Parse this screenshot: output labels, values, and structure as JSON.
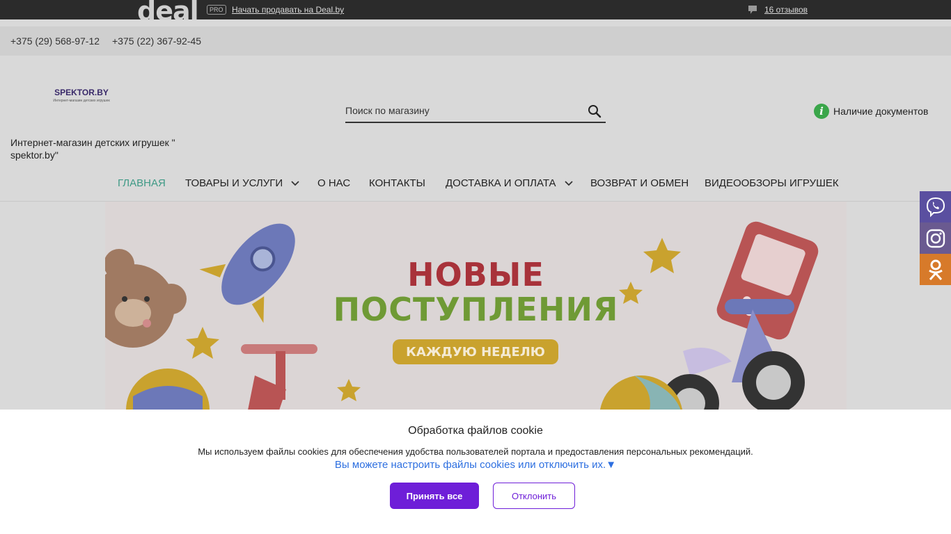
{
  "deal_bar": {
    "logo_text": "deal",
    "pro_badge": "PRO",
    "sell_link": "Начать продавать на Deal.by",
    "reviews_link": "16 отзывов"
  },
  "header": {
    "phones": [
      "+375 (29) 568-97-12",
      "+375 (22) 367-92-45"
    ],
    "logo_main": "SPEKTOR.BY",
    "logo_sub": "Интернет-магазин детских игрушек",
    "shop_title": "Интернет-магазин детских игрушек \" spektor.by\"",
    "search_placeholder": "Поиск по магазину",
    "docs_label": "Наличие документов"
  },
  "nav": {
    "items": [
      {
        "label": "Главная",
        "active": true
      },
      {
        "label": "Товары и услуги",
        "dropdown": true
      },
      {
        "label": "О нас"
      },
      {
        "label": "Контакты"
      },
      {
        "label": "Доставка и оплата",
        "dropdown": true
      },
      {
        "label": "Возврат и обмен"
      },
      {
        "label": "Видеообзоры игрушек"
      }
    ]
  },
  "banner": {
    "line1": "НОВЫЕ",
    "line2": "ПОСТУПЛЕНИЯ",
    "pill": "КАЖДУЮ НЕДЕЛЮ"
  },
  "social": [
    {
      "icon": "viber-icon",
      "color": "#5a4fa0"
    },
    {
      "icon": "instagram-icon",
      "color": "#6a5a90"
    },
    {
      "icon": "odnoklassniki-icon",
      "color": "#d77a2a"
    }
  ],
  "cookie": {
    "title": "Обработка файлов cookie",
    "text": "Мы используем файлы cookies для обеспечения удобства пользователей портала и предоставления персональных рекомендаций.",
    "settings_link": "Вы можете настроить файлы cookies или отключить их.▼",
    "accept_label": "Принять все",
    "decline_label": "Отклонить"
  },
  "colors": {
    "accent_purple": "#6e1ed8",
    "nav_active": "#3f9a86",
    "link_blue": "#2d6fe0"
  }
}
